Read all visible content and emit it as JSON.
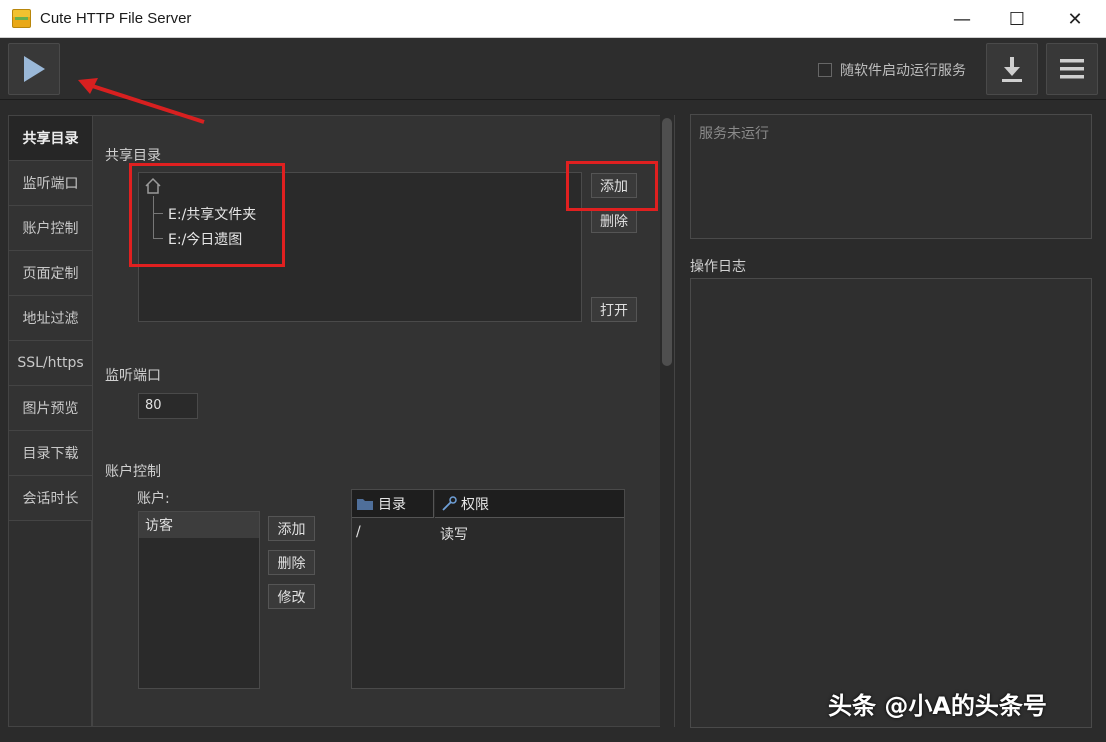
{
  "window": {
    "title": "Cute HTTP File Server",
    "minimize_glyph": "—",
    "maximize_glyph": "☐",
    "close_glyph": "✕"
  },
  "toolbar": {
    "autorun_label": "随软件启动运行服务",
    "autorun_checked": false,
    "icons": [
      "play-icon",
      "download-icon",
      "menu-icon"
    ]
  },
  "sidebar": {
    "tabs": [
      {
        "label": "共享目录",
        "active": true
      },
      {
        "label": "监听端口",
        "active": false
      },
      {
        "label": "账户控制",
        "active": false
      },
      {
        "label": "页面定制",
        "active": false
      },
      {
        "label": "地址过滤",
        "active": false
      },
      {
        "label": "SSL/https",
        "active": false
      },
      {
        "label": "图片预览",
        "active": false
      },
      {
        "label": "目录下载",
        "active": false
      },
      {
        "label": "会话时长",
        "active": false
      }
    ]
  },
  "shared_dirs": {
    "heading": "共享目录",
    "root_icon": "home-icon",
    "items": [
      "E:/共享文件夹",
      "E:/今日遗图"
    ],
    "add_label": "添加",
    "delete_label": "删除",
    "open_label": "打开"
  },
  "listen_port": {
    "heading": "监听端口",
    "value": "80"
  },
  "account": {
    "heading": "账户控制",
    "accounts_label": "账户:",
    "accounts": [
      "访客"
    ],
    "add_label": "添加",
    "delete_label": "删除",
    "edit_label": "修改",
    "table": {
      "col_dir": "目录",
      "col_perm": "权限",
      "rows": [
        {
          "dir": "/",
          "perm": "读写"
        }
      ]
    }
  },
  "status": {
    "text": "服务未运行"
  },
  "log": {
    "heading": "操作日志"
  },
  "watermark": "头条 @小A的头条号",
  "colors": {
    "annotation_red": "#e02020",
    "background": "#2b2b2b"
  }
}
